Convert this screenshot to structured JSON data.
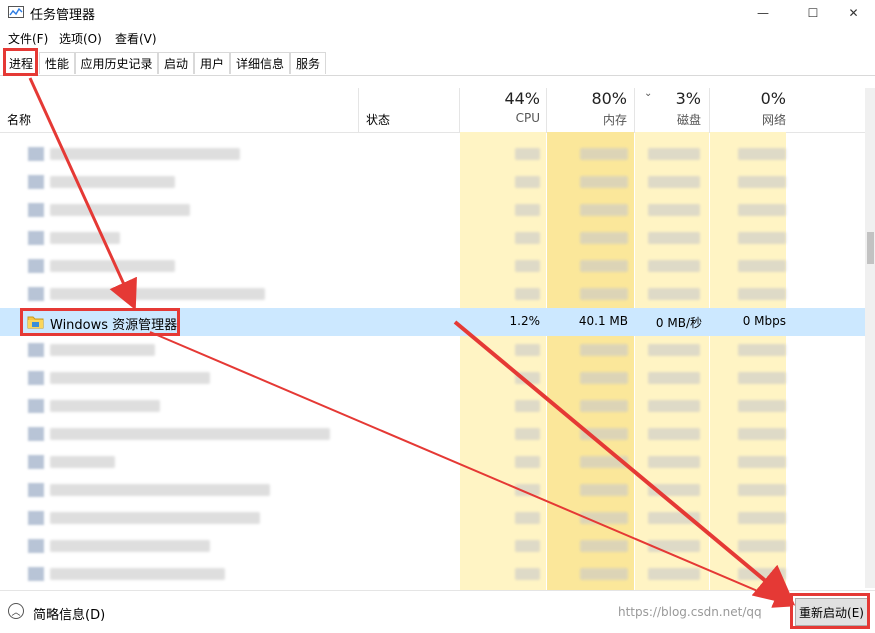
{
  "window": {
    "title": "任务管理器",
    "controls": {
      "minimize": "—",
      "maximize": "☐",
      "close": "✕"
    }
  },
  "menu": [
    "文件(F)",
    "选项(O)",
    "查看(V)"
  ],
  "tabs": [
    "进程",
    "性能",
    "应用历史记录",
    "启动",
    "用户",
    "详细信息",
    "服务"
  ],
  "active_tab": "进程",
  "columns": {
    "name": "名称",
    "status": "状态",
    "cpu": {
      "pct": "44%",
      "label": "CPU"
    },
    "memory": {
      "pct": "80%",
      "label": "内存"
    },
    "disk": {
      "pct": "3%",
      "label": "磁盘"
    },
    "network": {
      "pct": "0%",
      "label": "网络"
    }
  },
  "selected_process": {
    "name": "Windows 资源管理器",
    "cpu": "1.2%",
    "memory": "40.1 MB",
    "disk": "0 MB/秒",
    "network": "0 Mbps"
  },
  "footer": {
    "fewer_details": "简略信息(D)",
    "restart_button": "重新启动(E)",
    "watermark": "https://blog.csdn.net/qq"
  },
  "colors": {
    "selection": "#cce8ff",
    "heat_light": "#fff4c4",
    "heat_strong": "#fbe79a",
    "annotation": "#e53935"
  }
}
